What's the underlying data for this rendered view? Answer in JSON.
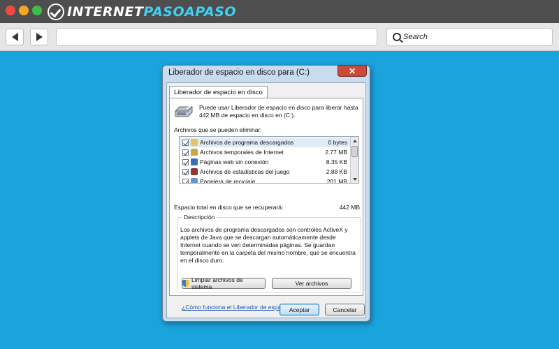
{
  "browser": {
    "logo_prefix": "INTERNET",
    "logo_accent": "PASOAPASO",
    "search_label": "Search"
  },
  "dialog": {
    "title": "Liberador de espacio en disco para  (C:)",
    "close_symbol": "✕",
    "tab_label": "Liberador de espacio en disco",
    "intro_text": "Puede usar Liberador de espacio en disco para liberar hasta 442 MB de espacio en disco en  (C:).",
    "files_label": "Archivos que se pueden eliminar:",
    "files": [
      {
        "name": "Archivos de programa descargados",
        "size": "0 bytes",
        "checked": true,
        "icon": "folder-icon",
        "color": "#e2c35f"
      },
      {
        "name": "Archivos temporales de Internet",
        "size": "2.77 MB",
        "checked": true,
        "icon": "lock-icon",
        "color": "#c9a63f"
      },
      {
        "name": "Páginas web sin conexión",
        "size": "8.35 KB",
        "checked": true,
        "icon": "webpage-icon",
        "color": "#3b6fb5"
      },
      {
        "name": "Archivos de estadísticas del juego",
        "size": "2.88 KB",
        "checked": true,
        "icon": "game-icon",
        "color": "#8b3a2f"
      },
      {
        "name": "Papelera de reciclaje",
        "size": "201 MB",
        "checked": true,
        "icon": "recycle-bin-icon",
        "color": "#6a93c9"
      }
    ],
    "total_label": "Espacio total en disco que se recuperará:",
    "total_value": "442 MB",
    "description_legend": "Descripción",
    "description_text": "Los archivos de programa descargados son controles ActiveX y applets de Java que se descargan automáticamente desde Internet cuando se ven determinadas páginas. Se guardan temporalmente en la carpeta del mismo nombre, que se encuentra en el disco duro.",
    "clean_system_button": "Limpiar archivos de sistema",
    "view_files_button": "Ver archivos",
    "help_link": "¿Cómo funciona el Liberador de espacio en disco?",
    "ok_button": "Aceptar",
    "cancel_button": "Cancelar"
  }
}
